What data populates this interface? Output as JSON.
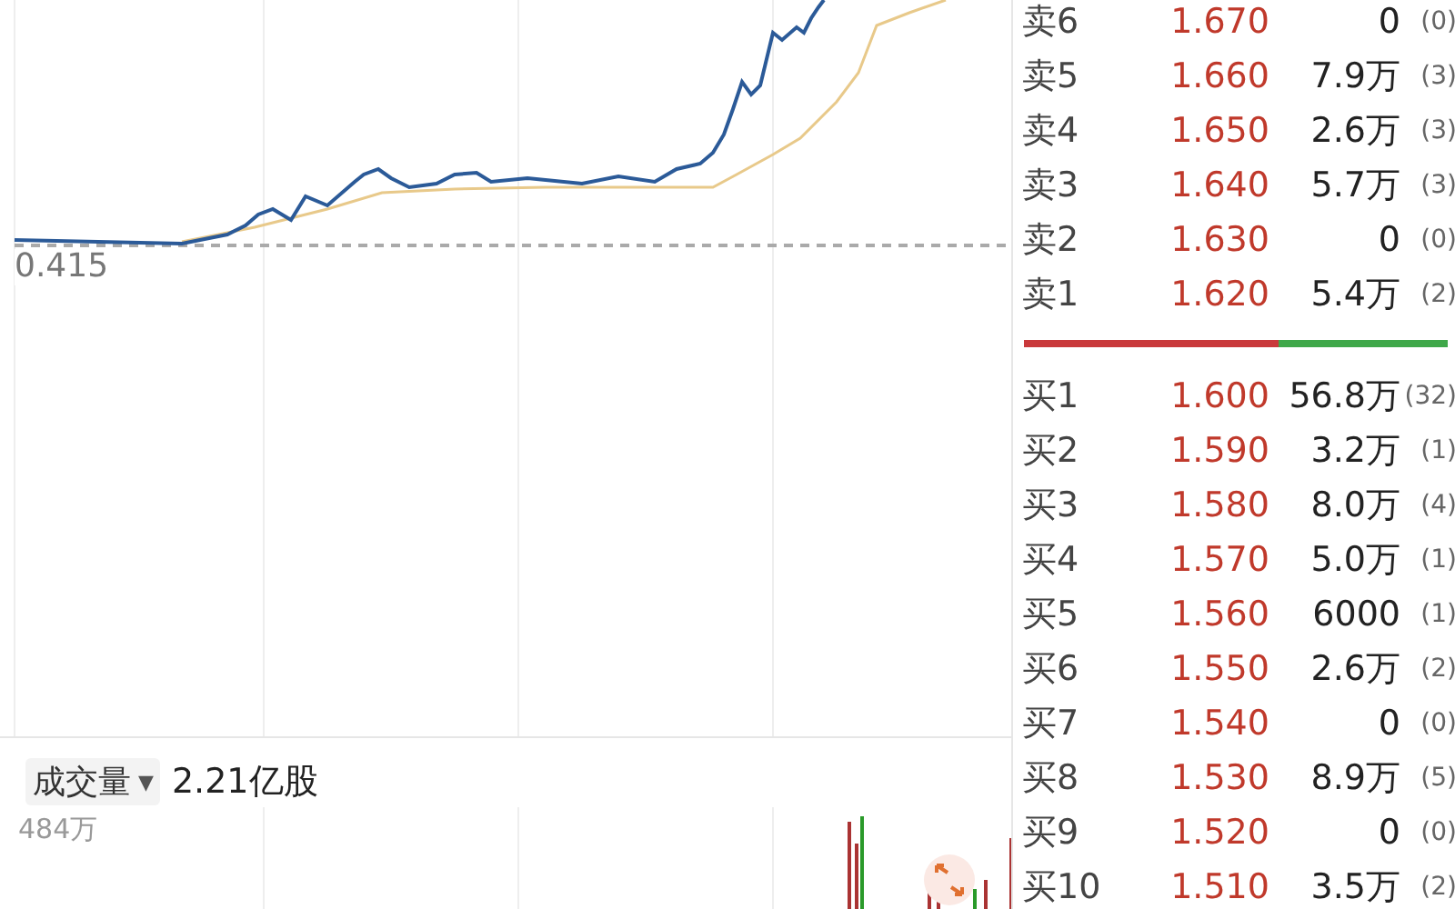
{
  "chart": {
    "baseline_label": "0.415"
  },
  "volume": {
    "indicator": "成交量",
    "dropdown_icon": "▼",
    "total": "2.21亿股",
    "axis_max": "484万"
  },
  "order_book": {
    "asks": [
      {
        "label": "卖6",
        "price": "1.670",
        "volume": "0",
        "orders": "(0)"
      },
      {
        "label": "卖5",
        "price": "1.660",
        "volume": "7.9万",
        "orders": "(3)"
      },
      {
        "label": "卖4",
        "price": "1.650",
        "volume": "2.6万",
        "orders": "(3)"
      },
      {
        "label": "卖3",
        "price": "1.640",
        "volume": "5.7万",
        "orders": "(3)"
      },
      {
        "label": "卖2",
        "price": "1.630",
        "volume": "0",
        "orders": "(0)"
      },
      {
        "label": "卖1",
        "price": "1.620",
        "volume": "5.4万",
        "orders": "(2)"
      }
    ],
    "ratio_bar": {
      "level": 0.6
    },
    "bids": [
      {
        "label": "买1",
        "price": "1.600",
        "volume": "56.8万",
        "orders": "(32)"
      },
      {
        "label": "买2",
        "price": "1.590",
        "volume": "3.2万",
        "orders": "(1)"
      },
      {
        "label": "买3",
        "price": "1.580",
        "volume": "8.0万",
        "orders": "(4)"
      },
      {
        "label": "买4",
        "price": "1.570",
        "volume": "5.0万",
        "orders": "(1)"
      },
      {
        "label": "买5",
        "price": "1.560",
        "volume": "6000",
        "orders": "(1)"
      },
      {
        "label": "买6",
        "price": "1.550",
        "volume": "2.6万",
        "orders": "(2)"
      },
      {
        "label": "买7",
        "price": "1.540",
        "volume": "0",
        "orders": "(0)"
      },
      {
        "label": "买8",
        "price": "1.530",
        "volume": "8.9万",
        "orders": "(5)"
      },
      {
        "label": "买9",
        "price": "1.520",
        "volume": "0",
        "orders": "(0)"
      },
      {
        "label": "买10",
        "price": "1.510",
        "volume": "3.5万",
        "orders": "(2)"
      }
    ]
  }
}
